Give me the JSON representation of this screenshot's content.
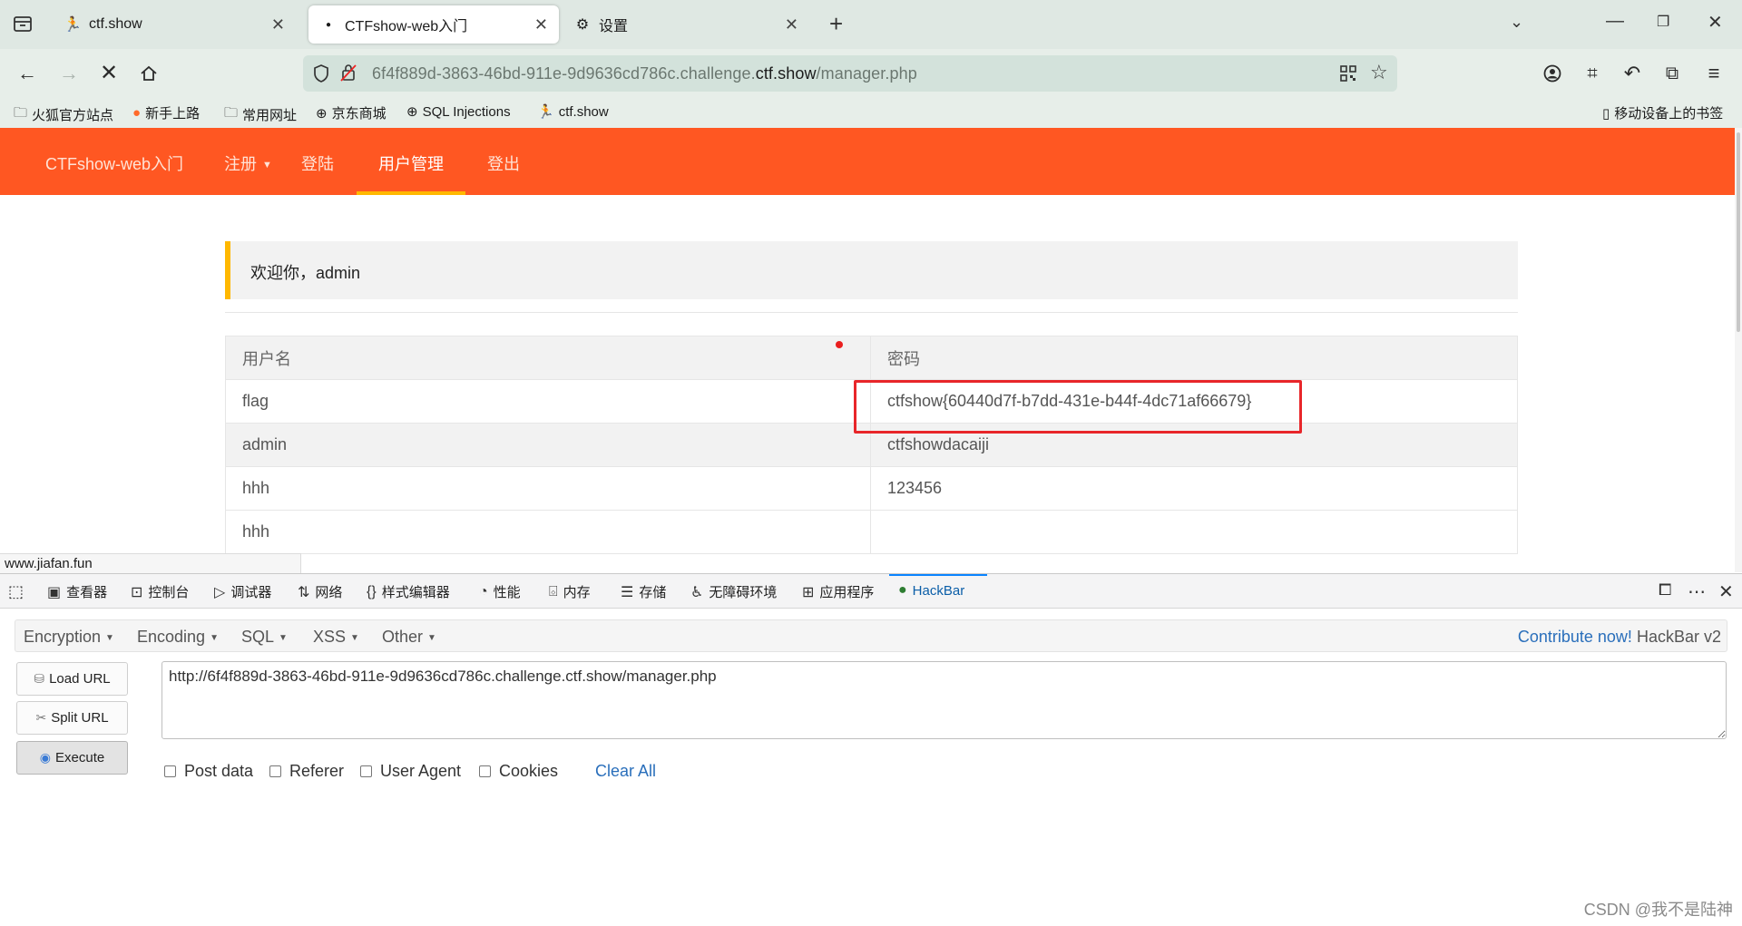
{
  "tabs": [
    {
      "label": "ctf.show",
      "icon": "ctfshow-runner-icon",
      "active": false
    },
    {
      "label": "CTFshow-web入门",
      "icon": "loading-dot-icon",
      "active": true
    },
    {
      "label": "设置",
      "icon": "gear-icon",
      "active": false
    }
  ],
  "navbar": {
    "url_prefix": "6f4f889d-3863-46bd-911e-9d9636cd786c.challenge.",
    "url_domain": "ctf.show",
    "url_path": "/manager.php"
  },
  "bookmarks": [
    {
      "label": "火狐官方站点",
      "icon": "folder-icon"
    },
    {
      "label": "新手上路",
      "icon": "firefox-icon"
    },
    {
      "label": "常用网址",
      "icon": "folder-icon"
    },
    {
      "label": "京东商城",
      "icon": "globe-icon"
    },
    {
      "label": "SQL Injections",
      "icon": "globe-icon"
    },
    {
      "label": "ctf.show",
      "icon": "ctfshow-runner-icon"
    }
  ],
  "bookmarks_right": "移动设备上的书签",
  "site": {
    "brand": "CTFshow-web入门",
    "nav": [
      "注册",
      "登陆",
      "用户管理",
      "登出"
    ],
    "active_nav": "用户管理",
    "welcome": "欢迎你，admin",
    "table": {
      "headers": [
        "用户名",
        "密码"
      ],
      "rows": [
        [
          "flag",
          "ctfshow{60440d7f-b7dd-431e-b44f-4dc71af66679}"
        ],
        [
          "admin",
          "ctfshowdacaiji"
        ],
        [
          "hhh",
          "123456"
        ],
        [
          "hhh",
          ""
        ]
      ]
    }
  },
  "status_url": "www.jiafan.fun",
  "devtools": {
    "tabs": [
      "查看器",
      "控制台",
      "调试器",
      "网络",
      "样式编辑器",
      "性能",
      "内存",
      "存储",
      "无障碍环境",
      "应用程序",
      "HackBar"
    ],
    "active_tab": "HackBar"
  },
  "hackbar": {
    "menus": [
      "Encryption",
      "Encoding",
      "SQL",
      "XSS",
      "Other"
    ],
    "contribute_link": "Contribute now!",
    "version": "HackBar v2",
    "buttons": [
      "Load URL",
      "Split URL",
      "Execute"
    ],
    "url_value": "http://6f4f889d-3863-46bd-911e-9d9636cd786c.challenge.ctf.show/manager.php",
    "checkboxes": [
      "Post data",
      "Referer",
      "User Agent",
      "Cookies"
    ],
    "clear_all": "Clear All"
  },
  "watermark": "CSDN @我不是陆神",
  "colors": {
    "site_nav": "#ff5722",
    "nav_underline": "#ffb800",
    "highlight_box": "#e8262a",
    "link": "#2a6fbb"
  }
}
